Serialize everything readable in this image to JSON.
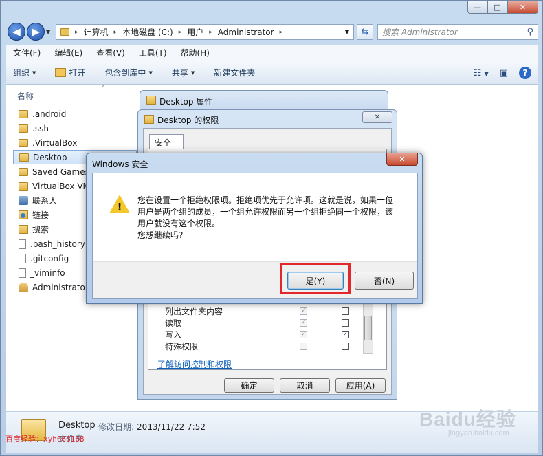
{
  "explorer": {
    "caption": {
      "minimize": "—",
      "maximize": "□",
      "close": "✕"
    },
    "address": {
      "crumbs": [
        "计算机",
        "本地磁盘 (C:)",
        "用户",
        "Administrator"
      ]
    },
    "search_placeholder": "搜索 Administrator",
    "menu": [
      "文件(F)",
      "编辑(E)",
      "查看(V)",
      "工具(T)",
      "帮助(H)"
    ],
    "commands": {
      "organize": "组织",
      "open": "打开",
      "include_library": "包含到库中",
      "share": "共享",
      "new_folder": "新建文件夹"
    },
    "column_header": "名称",
    "files": [
      {
        "name": ".android",
        "icon": "folder-icon"
      },
      {
        "name": ".ssh",
        "icon": "folder-icon"
      },
      {
        "name": ".VirtualBox",
        "icon": "folder-icon"
      },
      {
        "name": "Desktop",
        "icon": "folder-icon",
        "selected": true
      },
      {
        "name": "Saved Games",
        "icon": "folder-icon"
      },
      {
        "name": "VirtualBox VM",
        "icon": "folder-icon"
      },
      {
        "name": "联系人",
        "icon": "contacts-icon"
      },
      {
        "name": "链接",
        "icon": "links-icon"
      },
      {
        "name": "搜索",
        "icon": "search-folder-icon"
      },
      {
        "name": ".bash_history",
        "icon": "file-icon"
      },
      {
        "name": ".gitconfig",
        "icon": "file-icon"
      },
      {
        "name": "_viminfo",
        "icon": "file-icon"
      },
      {
        "name": "Administrator",
        "icon": "user-icon"
      }
    ],
    "details": {
      "name": "Desktop",
      "modified_label": "修改日期:",
      "modified_value": "2013/11/22 7:52",
      "type": "文件夹"
    }
  },
  "properties_window": {
    "title": "Desktop 属性"
  },
  "permissions_window": {
    "title": "Desktop 的权限",
    "close": "✕",
    "tab": "安全",
    "permissions": [
      {
        "name": "列出文件夹内容",
        "allow": true,
        "deny": false
      },
      {
        "name": "读取",
        "allow": true,
        "deny": false
      },
      {
        "name": "写入",
        "allow": true,
        "deny": true
      },
      {
        "name": "特殊权限",
        "allow": false,
        "deny": false
      }
    ],
    "link": "了解访问控制和权限",
    "buttons": {
      "ok": "确定",
      "cancel": "取消",
      "apply": "应用(A)"
    }
  },
  "security_dialog": {
    "title": "Windows 安全",
    "close": "✕",
    "message_lines": [
      "您在设置一个拒绝权限项。拒绝项优先于允许项。这就是说，如果一位",
      "用户是两个组的成员，一个组允许权限而另一个组拒绝同一个权限，该",
      "用户就没有这个权限。",
      "您想继续吗?"
    ],
    "buttons": {
      "yes": "是(Y)",
      "no": "否(N)"
    }
  },
  "watermarks": {
    "left": "百度经验：xyh666168",
    "right": "Baidu经验",
    "right_sub": "jingyan.baidu.com"
  },
  "colors": {
    "highlight": "#e2262c",
    "accent": "#2c68c6"
  }
}
